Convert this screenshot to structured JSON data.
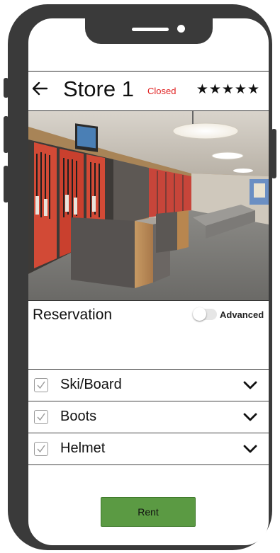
{
  "store": {
    "title": "Store 1",
    "status": "Closed",
    "rating_stars": "★★★★★",
    "rating_value": 5,
    "rating_max": 5
  },
  "reservation": {
    "label": "Reservation",
    "advanced_label": "Advanced",
    "advanced_enabled": false
  },
  "items": [
    {
      "label": "Ski/Board",
      "checked": true
    },
    {
      "label": "Boots",
      "checked": true
    },
    {
      "label": "Helmet",
      "checked": true
    }
  ],
  "actions": {
    "rent_label": "Rent"
  },
  "colors": {
    "device_frame": "#3a3a3a",
    "status_closed": "#e02020",
    "rent_button": "#5b9a43"
  },
  "icons": {
    "back": "arrow-left-icon",
    "expand": "chevron-down-icon",
    "check": "check-icon"
  }
}
